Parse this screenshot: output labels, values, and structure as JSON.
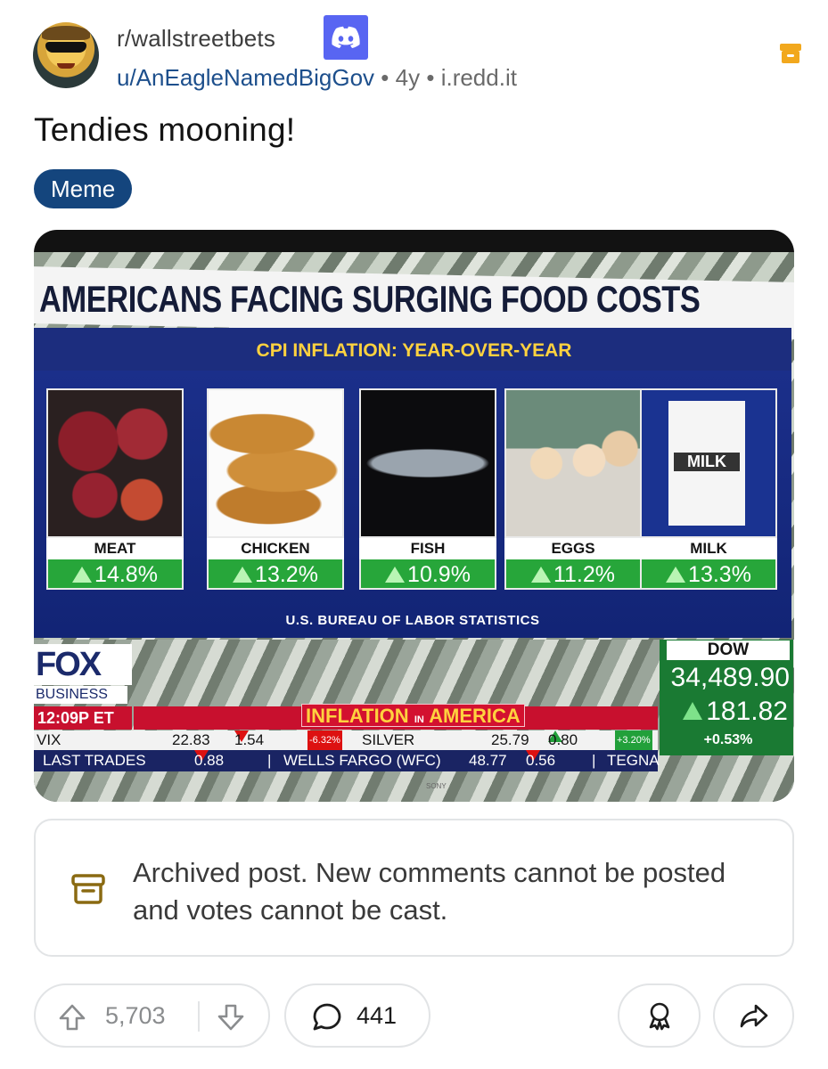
{
  "header": {
    "subreddit": "r/wallstreetbets",
    "username": "u/AnEagleNamedBigGov",
    "separator": "•",
    "age": "4y",
    "domain": "i.redd.it"
  },
  "post": {
    "title": "Tendies mooning!",
    "flair": "Meme"
  },
  "image": {
    "headline": "AMERICANS FACING SURGING FOOD COSTS",
    "subheadline": "CPI INFLATION: YEAR-OVER-YEAR",
    "source": "U.S. BUREAU OF LABOR STATISTICS",
    "items": [
      {
        "label": "MEAT",
        "change": "14.8%"
      },
      {
        "label": "CHICKEN",
        "change": "13.2%"
      },
      {
        "label": "FISH",
        "change": "10.9%"
      },
      {
        "label": "EGGS",
        "change": "11.2%"
      },
      {
        "label": "MILK",
        "change": "13.3%"
      }
    ],
    "milk_carton_word": "MILK",
    "network_logo": "FOX",
    "network_sub": "BUSINESS",
    "time": "12:09P ET",
    "banner": {
      "part1": "INFLATION",
      "part2": "IN",
      "part3": "AMERICA"
    },
    "ticker_row1": {
      "vix": "VIX",
      "v1": "22.83",
      "v2": "1.54",
      "v3": "-6.32%",
      "silver": "SILVER",
      "s1": "25.79",
      "s2": "0.80",
      "s3": "+3.20%"
    },
    "ticker_row2": {
      "last_trades": "LAST TRADES",
      "v1": "0.88",
      "sep": "|",
      "wfc": "WELLS FARGO (WFC)",
      "w1": "48.77",
      "w2": "0.56",
      "sep2": "|",
      "tegna": "TEGNA"
    },
    "dow": {
      "label": "DOW",
      "value": "34,489.90",
      "change": "181.82",
      "percent": "+0.53%"
    },
    "brand": "SONY"
  },
  "notice": {
    "text": "Archived post. New comments cannot be posted and votes cannot be cast."
  },
  "actions": {
    "votes": "5,703",
    "comments": "441"
  },
  "colors": {
    "flair_bg": "#14457d",
    "username": "#1d4f8c",
    "discord": "#5865f2",
    "archive_icon_top": "#f2a81d",
    "archive_icon_notice": "#8a6a12"
  }
}
